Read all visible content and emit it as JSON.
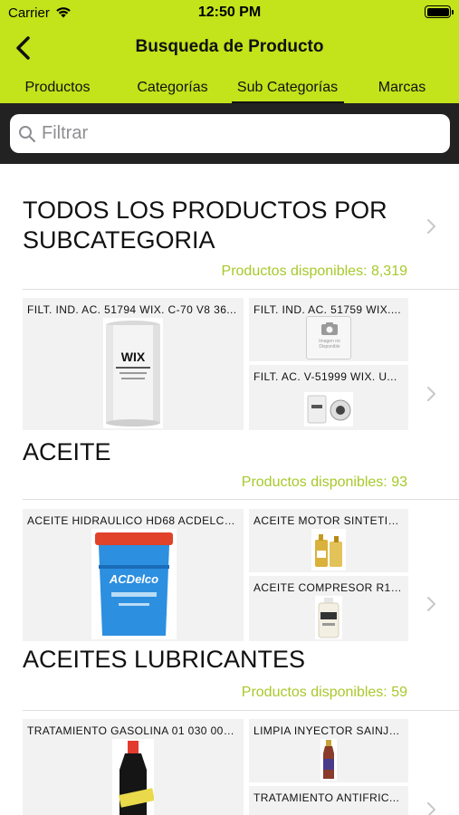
{
  "status_bar": {
    "carrier": "Carrier",
    "time": "12:50 PM"
  },
  "header": {
    "title": "Busqueda de Producto"
  },
  "tabs": [
    {
      "label": "Productos"
    },
    {
      "label": "Categorías"
    },
    {
      "label": "Sub Categorías",
      "selected": true
    },
    {
      "label": "Marcas"
    }
  ],
  "search": {
    "placeholder": "Filtrar",
    "value": ""
  },
  "sections": [
    {
      "title": "TODOS LOS PRODUCTOS POR SUBCATEGORIA",
      "count": "Productos disponibles: 8,319",
      "cards": [
        {
          "label": "FILT. IND. AC. 51794 WIX. C-70 V8 36...",
          "image": "oil-filter-wix-51794",
          "image_text": "WIX"
        },
        {
          "label": "FILT. IND. AC. 51759  WIX....",
          "image": "no-image-placeholder",
          "image_text": "Imagen no Disponible"
        },
        {
          "label": "FILT. AC. V-51999  WIX. U...",
          "image": "oil-filters-pair"
        }
      ]
    },
    {
      "title": "ACEITE",
      "count": "Productos disponibles: 93",
      "cards": [
        {
          "label": "ACEITE HIDRAULICO HD68 ACDELCO...",
          "image": "acdelco-hydraulic-bucket",
          "image_text": "ACDelco"
        },
        {
          "label": "ACEITE MOTOR SINTETIC...",
          "image": "motor-oil-bottles"
        },
        {
          "label": "ACEITE COMPRESOR R13...",
          "image": "compressor-oil-bottle"
        }
      ]
    },
    {
      "title": "ACEITES LUBRICANTES",
      "count": "Productos disponibles: 59",
      "cards": [
        {
          "label": "TRATAMIENTO GASOLINA 01 030 004...",
          "image": "gasoline-treatment-bottle"
        },
        {
          "label": "LIMPIA INYECTOR SAINJE...",
          "image": "injector-cleaner-bottle"
        },
        {
          "label": "TRATAMIENTO ANTIFRIC...",
          "image": "antifriction-treatment"
        }
      ]
    }
  ],
  "colors": {
    "accent": "#c3e31a",
    "count_text": "#a7c92b",
    "search_bar_bg": "#222222"
  }
}
